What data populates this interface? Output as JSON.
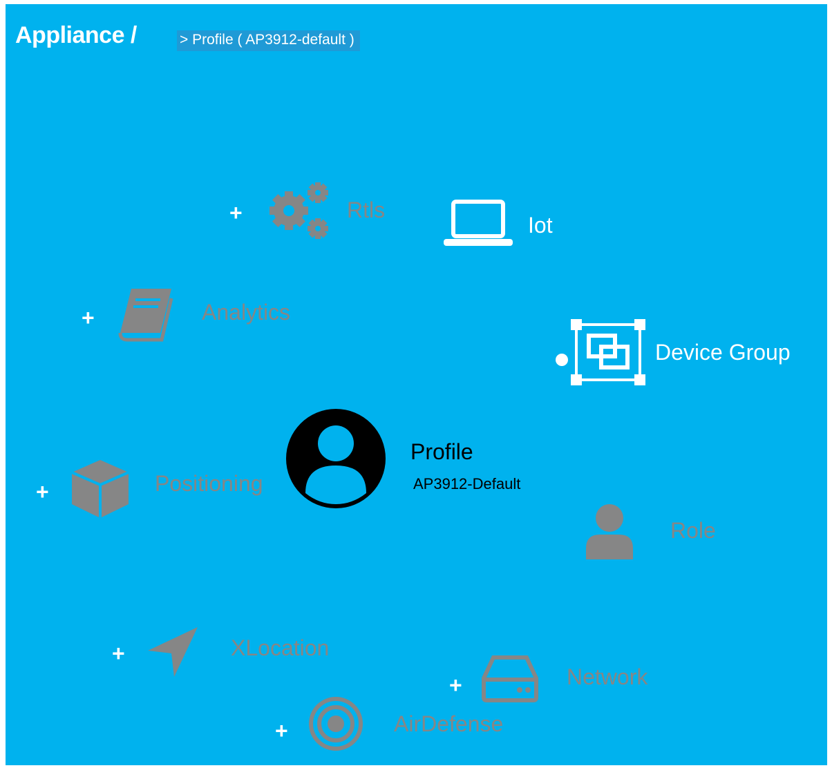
{
  "breadcrumb": {
    "root": "Appliance /",
    "current": "> Profile ( AP3912-default )"
  },
  "center": {
    "title": "Profile",
    "subtitle": "AP3912-Default"
  },
  "nodes": {
    "rtls": "Rtls",
    "iot": "Iot",
    "analytics": "Analytics",
    "device_group": "Device Group",
    "positioning": "Positioning",
    "role": "Role",
    "xlocation": "XLocation",
    "network": "Network",
    "airdefense": "AirDefense"
  },
  "plus_symbol": "+",
  "icons": {
    "rtls": "gears-icon",
    "iot": "laptop-icon",
    "analytics": "book-icon",
    "device_group": "group-select-icon",
    "positioning": "cube-icon",
    "profile": "user-circle-icon",
    "role": "user-icon",
    "xlocation": "location-arrow-icon",
    "network": "hard-drive-icon",
    "airdefense": "target-icon"
  },
  "colors": {
    "background": "#00b2ee",
    "inactive": "#868686",
    "active": "#ffffff",
    "center": "#000000",
    "breadcrumb_highlight": "#1f9ad6"
  }
}
